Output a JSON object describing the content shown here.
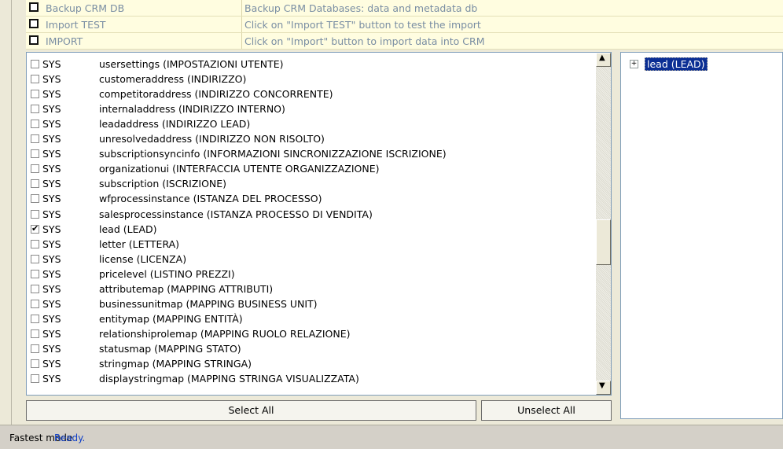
{
  "top_table": [
    {
      "name": "Backup CRM DB",
      "description": "Backup CRM Databases: data and metadata db"
    },
    {
      "name": "Import TEST",
      "description": "Click on \"Import TEST\" button to test the import"
    },
    {
      "name": "IMPORT",
      "description": "Click on \"Import\" button to import data into CRM"
    }
  ],
  "entity_list": [
    {
      "type": "SYS",
      "text": "usersettings  (IMPOSTAZIONI UTENTE)",
      "checked": false
    },
    {
      "type": "SYS",
      "text": "customeraddress  (INDIRIZZO)",
      "checked": false
    },
    {
      "type": "SYS",
      "text": "competitoraddress  (INDIRIZZO CONCORRENTE)",
      "checked": false
    },
    {
      "type": "SYS",
      "text": "internaladdress  (INDIRIZZO INTERNO)",
      "checked": false
    },
    {
      "type": "SYS",
      "text": "leadaddress  (INDIRIZZO LEAD)",
      "checked": false
    },
    {
      "type": "SYS",
      "text": "unresolvedaddress  (INDIRIZZO NON RISOLTO)",
      "checked": false
    },
    {
      "type": "SYS",
      "text": "subscriptionsyncinfo  (INFORMAZIONI SINCRONIZZAZIONE ISCRIZIONE)",
      "checked": false
    },
    {
      "type": "SYS",
      "text": "organizationui  (INTERFACCIA UTENTE ORGANIZZAZIONE)",
      "checked": false
    },
    {
      "type": "SYS",
      "text": "subscription  (ISCRIZIONE)",
      "checked": false
    },
    {
      "type": "SYS",
      "text": "wfprocessinstance  (ISTANZA DEL PROCESSO)",
      "checked": false
    },
    {
      "type": "SYS",
      "text": "salesprocessinstance  (ISTANZA PROCESSO DI VENDITA)",
      "checked": false
    },
    {
      "type": "SYS",
      "text": "lead  (LEAD)",
      "checked": true
    },
    {
      "type": "SYS",
      "text": "letter  (LETTERA)",
      "checked": false
    },
    {
      "type": "SYS",
      "text": "license  (LICENZA)",
      "checked": false
    },
    {
      "type": "SYS",
      "text": "pricelevel  (LISTINO PREZZI)",
      "checked": false
    },
    {
      "type": "SYS",
      "text": "attributemap  (MAPPING ATTRIBUTI)",
      "checked": false
    },
    {
      "type": "SYS",
      "text": "businessunitmap  (MAPPING BUSINESS UNIT)",
      "checked": false
    },
    {
      "type": "SYS",
      "text": "entitymap  (MAPPING ENTITÀ)",
      "checked": false
    },
    {
      "type": "SYS",
      "text": "relationshiprolemap  (MAPPING RUOLO RELAZIONE)",
      "checked": false
    },
    {
      "type": "SYS",
      "text": "statusmap  (MAPPING STATO)",
      "checked": false
    },
    {
      "type": "SYS",
      "text": "stringmap  (MAPPING STRINGA)",
      "checked": false
    },
    {
      "type": "SYS",
      "text": "displaystringmap  (MAPPING STRINGA VISUALIZZATA)",
      "checked": false
    }
  ],
  "buttons": {
    "select_all": "Select All",
    "unselect_all": "Unselect All"
  },
  "tree": {
    "expander": "+",
    "node": "lead  (LEAD)"
  },
  "status": {
    "mode": "Fastest mode",
    "state": "Ready."
  },
  "colors": {
    "tree_selection": "#0b2e94",
    "status_ready": "#1040c8",
    "top_text": "#7a8ea3"
  }
}
